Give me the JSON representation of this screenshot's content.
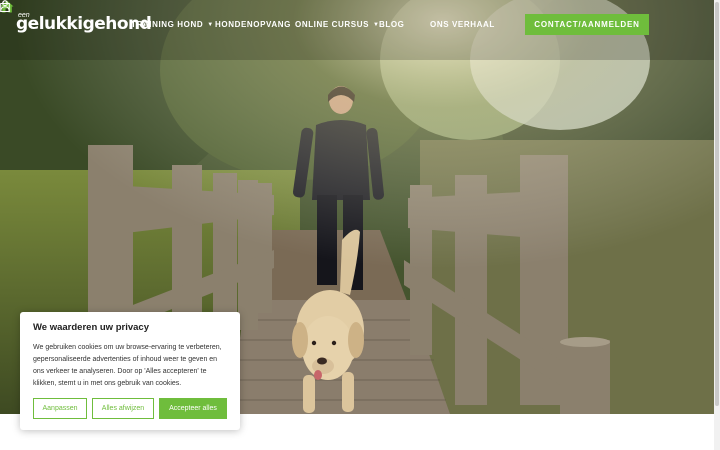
{
  "site": {
    "logo_small": "een",
    "logo_main": "gelukkigehond"
  },
  "nav": {
    "items": [
      {
        "label": "TRAINING HOND",
        "has_dropdown": true
      },
      {
        "label": "HONDENOPVANG",
        "has_dropdown": false
      },
      {
        "label": "ONLINE CURSUS",
        "has_dropdown": true
      },
      {
        "label": "BLOG",
        "has_dropdown": false
      },
      {
        "label": "ONS VERHAAL",
        "has_dropdown": false
      }
    ],
    "home_icon": "home-icon",
    "cta_label": "CONTACT/AANMELDEN",
    "account_icon": "user-icon",
    "cart_icon": "shopping-bag-icon"
  },
  "hero": {
    "image_description_icon": "photo-woman-dog-bridge"
  },
  "cookie": {
    "title": "We waarderen uw privacy",
    "text": "We gebruiken cookies om uw browse-ervaring te verbeteren, gepersonaliseerde advertenties of inhoud weer te geven en ons verkeer te analyseren. Door op 'Alles accepteren' te klikken, stemt u in met ons gebruik van cookies.",
    "buttons": {
      "customize": "Aanpassen",
      "reject": "Alles afwijzen",
      "accept": "Accepteer alles"
    }
  },
  "colors": {
    "accent": "#6fbd3c",
    "nav_text": "#ffffff"
  }
}
